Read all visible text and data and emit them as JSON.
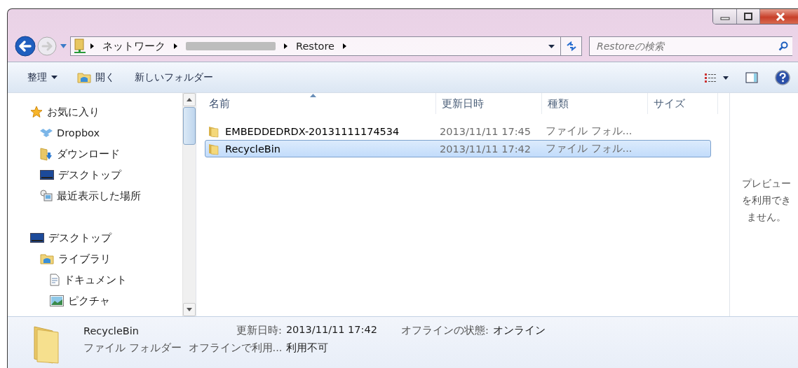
{
  "address_bar": {
    "crumbs": [
      {
        "kind": "text",
        "label": "ネットワーク"
      },
      {
        "kind": "redacted"
      },
      {
        "kind": "text",
        "label": "Restore"
      }
    ]
  },
  "search": {
    "placeholder": "Restoreの検索"
  },
  "toolbar": {
    "items": [
      {
        "kind": "menu",
        "label": "整理"
      },
      {
        "kind": "open",
        "label": "開く"
      },
      {
        "kind": "plain",
        "label": "新しいフォルダー"
      }
    ]
  },
  "navigation": {
    "items": [
      {
        "kind": "star",
        "label": "お気に入り",
        "children": [
          {
            "kind": "dropbox",
            "label": "Dropbox"
          },
          {
            "kind": "download",
            "label": "ダウンロード"
          },
          {
            "kind": "desktop",
            "label": "デスクトップ"
          },
          {
            "kind": "recent",
            "label": "最近表示した場所"
          }
        ]
      },
      {
        "kind": "desktop",
        "label": "デスクトップ",
        "children": [
          {
            "kind": "library",
            "label": "ライブラリ",
            "children": [
              {
                "kind": "document",
                "label": "ドキュメント"
              },
              {
                "kind": "picture",
                "label": "ピクチャ"
              }
            ]
          }
        ]
      }
    ]
  },
  "file_list": {
    "columns": [
      {
        "label": "名前",
        "sorted": true
      },
      {
        "label": "更新日時",
        "sorted": false
      },
      {
        "label": "種類",
        "sorted": false
      },
      {
        "label": "サイズ",
        "sorted": false
      }
    ],
    "rows": [
      {
        "name": "EMBEDDEDRDX-20131111174534",
        "modified": "2013/11/11 17:45",
        "type": "ファイル フォル...",
        "selected": false
      },
      {
        "name": "RecycleBin",
        "modified": "2013/11/11 17:42",
        "type": "ファイル フォル...",
        "selected": true
      }
    ]
  },
  "preview_pane": {
    "message": "プレビューを利用できません。"
  },
  "details_pane": {
    "name": "RecycleBin",
    "type": "ファイル フォルダー",
    "properties": [
      {
        "label": "更新日時:",
        "value": "2013/11/11 17:42"
      },
      {
        "label": "オフラインの状態:",
        "value": "オンライン"
      },
      {
        "label": "オフラインで利用...",
        "value": "利用不可"
      }
    ]
  }
}
